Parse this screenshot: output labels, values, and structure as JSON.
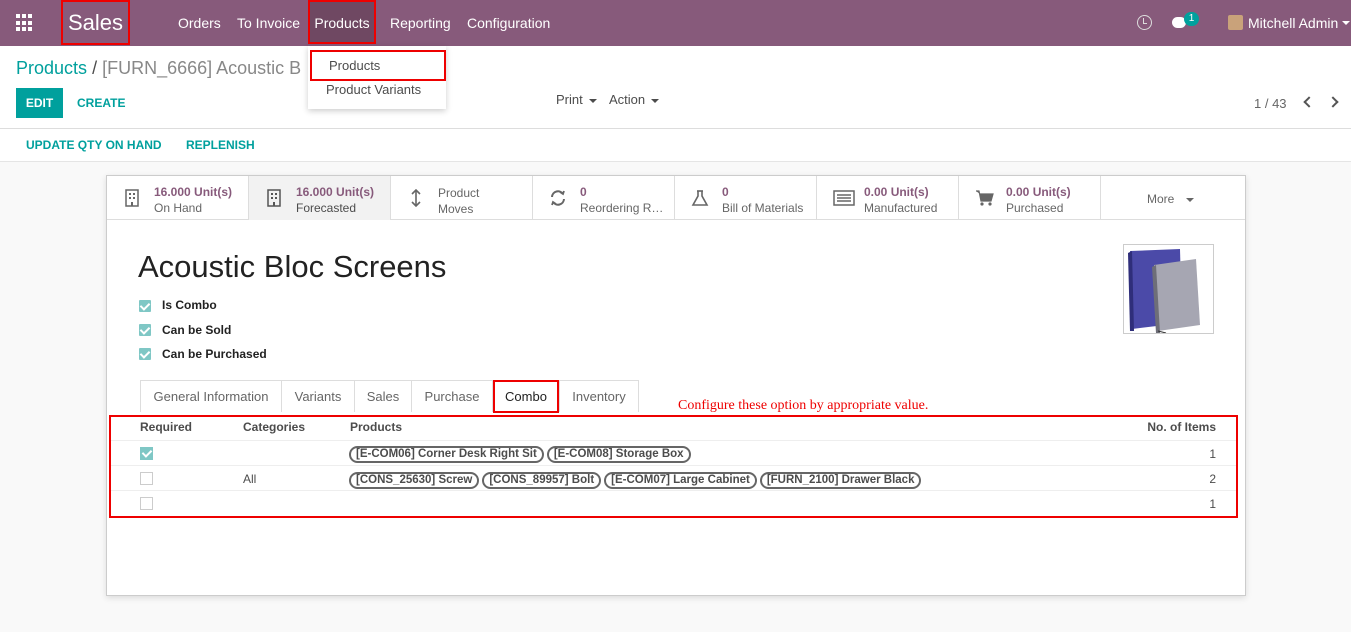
{
  "navbar": {
    "app_name": "Sales",
    "menu": [
      "Orders",
      "To Invoice",
      "Products",
      "Reporting",
      "Configuration"
    ],
    "chat_count": "1",
    "user": "Mitchell Admin"
  },
  "dropdown": {
    "items": [
      "Products",
      "Product Variants"
    ]
  },
  "breadcrumb": {
    "parent": "Products",
    "separator": "/",
    "current": "[FURN_6666] Acoustic B"
  },
  "buttons": {
    "edit": "EDIT",
    "create": "CREATE",
    "print": "Print",
    "action": "Action"
  },
  "pager": "1 / 43",
  "statusbar": {
    "update_qty": "UPDATE QTY ON HAND",
    "replenish": "REPLENISH"
  },
  "smart_buttons": [
    {
      "value": "16.000 Unit(s)",
      "label": "On Hand",
      "icon": "building-icon"
    },
    {
      "value": "16.000 Unit(s)",
      "label": "Forecasted",
      "icon": "building-icon"
    },
    {
      "value": "Product",
      "label": "Moves",
      "icon": "updown-arrow-icon"
    },
    {
      "value": "0",
      "label": "Reordering Rules",
      "icon": "refresh-icon"
    },
    {
      "value": "0",
      "label": "Bill of Materials",
      "icon": "flask-icon"
    },
    {
      "value": "0.00 Unit(s)",
      "label": "Manufactured",
      "icon": "list-icon"
    },
    {
      "value": "0.00 Unit(s)",
      "label": "Purchased",
      "icon": "cart-icon"
    }
  ],
  "more": "More",
  "product": {
    "name": "Acoustic Bloc Screens",
    "checks": [
      "Is Combo",
      "Can be Sold",
      "Can be Purchased"
    ]
  },
  "tabs": [
    "General Information",
    "Variants",
    "Sales",
    "Purchase",
    "Combo",
    "Inventory"
  ],
  "annotation": "Configure these option by appropriate value.",
  "combo_table": {
    "headers": {
      "required": "Required",
      "categories": "Categories",
      "products": "Products",
      "items": "No. of Items"
    },
    "rows": [
      {
        "required": true,
        "category": "",
        "products": [
          "[E-COM06] Corner Desk Right Sit",
          "[E-COM08] Storage Box"
        ],
        "items": "1"
      },
      {
        "required": false,
        "category": "All",
        "products": [
          "[CONS_25630] Screw",
          "[CONS_89957] Bolt",
          "[E-COM07] Large Cabinet",
          "[FURN_2100] Drawer Black"
        ],
        "items": "2"
      },
      {
        "required": false,
        "category": "",
        "products": [],
        "items": "1"
      }
    ]
  }
}
